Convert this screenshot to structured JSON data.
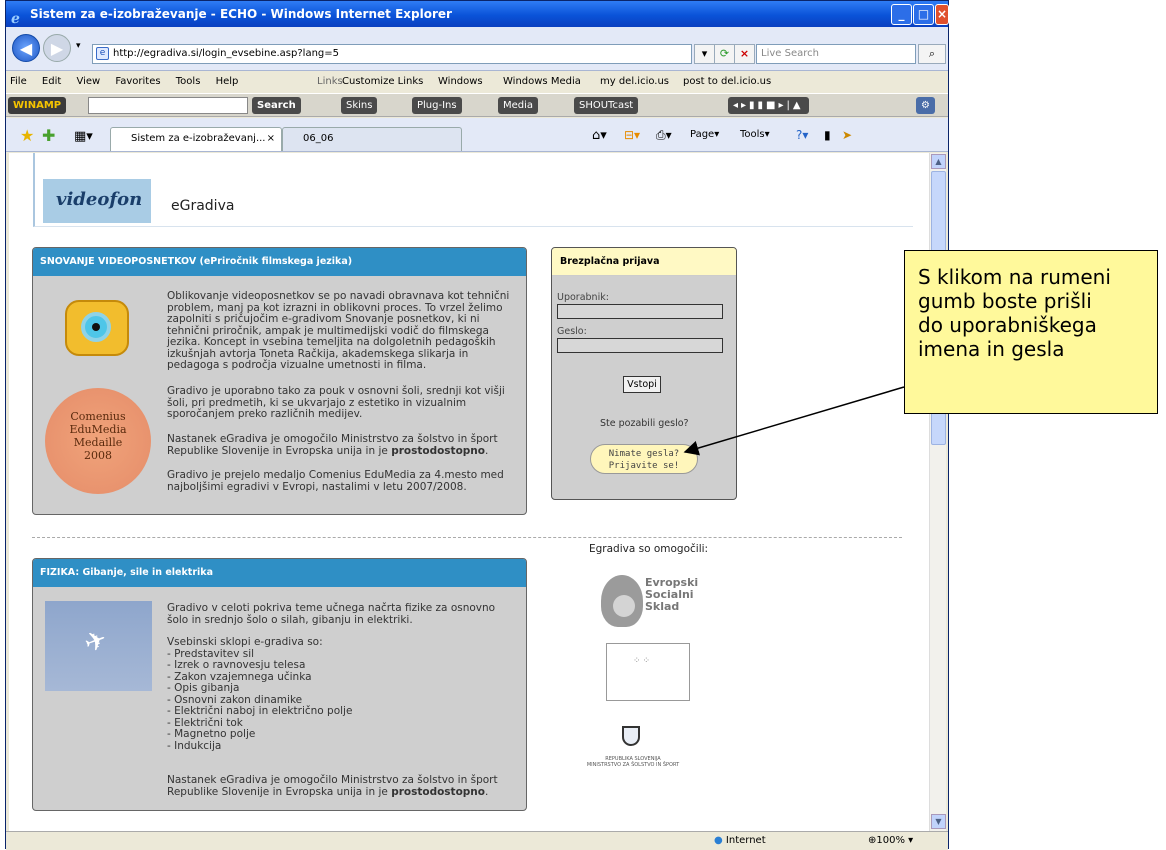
{
  "window": {
    "title": "Sistem za e-izobraževanje - ECHO - Windows Internet Explorer"
  },
  "address": {
    "url": "http://egradiva.si/login_evsebine.asp?lang=5",
    "search_placeholder": "Live Search"
  },
  "menu": {
    "items": [
      "File",
      "Edit",
      "View",
      "Favorites",
      "Tools",
      "Help"
    ],
    "links_label": "Links",
    "links": [
      "Customize Links",
      "Windows",
      "Windows Media",
      "my del.icio.us",
      "post to del.icio.us"
    ]
  },
  "winamp": {
    "brand": "WINAMP",
    "search_btn": "Search",
    "buttons": [
      "Skins",
      "Plug-Ins",
      "Media",
      "SHOUTcast"
    ]
  },
  "tabs": {
    "items": [
      "Sistem za e-izobraževanj...",
      "06_06"
    ],
    "commands": [
      "Page",
      "Tools"
    ]
  },
  "site": {
    "brand": "videofon",
    "title": "eGradiva"
  },
  "course1": {
    "header": "SNOVANJE VIDEOPOSNETKOV (ePriročnik filmskega jezika)",
    "p1": "Oblikovanje videoposnetkov se po navadi obravnava kot tehnični\nproblem, manj pa kot izrazni in oblikovni proces. To vrzel želimo\nzapolniti s pričujočim e-gradivom Snovanje posnetkov, ki ni\ntehnični priročnik, ampak je multimedijski vodič do filmskega\njezika. Koncept in vsebina temeljita na dolgoletnih pedagoških\nizkušnjah avtorja Toneta Račkija, akademskega slikarja in\npedagoga s področja vizualne umetnosti in filma.",
    "p2": "Gradivo je uporabno tako za pouk v osnovni šoli, srednji kot višji\nšoli, pri predmetih, ki se ukvarjajo z estetiko in vizualnim\nsporočanjem preko različnih medijev.",
    "p3_text": "Nastanek eGradiva je omogočilo Ministrstvo za šolstvo in šport\nRepublike Slovenije in Evropska unija in je ",
    "p3_bold": "prostodostopno",
    "p4": "Gradivo je prejelo medaljo Comenius EduMedia za 4.mesto med\nnajboljšimi egradivi v Evropi, nastalimi v letu 2007/2008.",
    "medal": "Comenius\nEduMedia\nMedaille\n2008"
  },
  "login": {
    "header": "Brezplačna prijava",
    "user_label": "Uporabnik:",
    "pass_label": "Geslo:",
    "submit": "Vstopi",
    "forgot": "Ste pozabili geslo?",
    "register": "Nimate gesla?\nPrijavite se!"
  },
  "course2": {
    "header": "FIZIKA: Gibanje, sile in elektrika",
    "p1": "Gradivo v celoti pokriva teme učnega načrta fizike za osnovno\nšolo in srednjo šolo o silah, gibanju in elektriki.",
    "p2": "Vsebinski sklopi e-gradiva so:\n- Predstavitev sil\n- Izrek o ravnovesju telesa\n- Zakon vzajemnega učinka\n- Opis gibanja\n- Osnovni zakon dinamike\n- Električni naboj in električno polje\n- Električni tok\n- Magnetno polje\n- Indukcija",
    "p3_text": "Nastanek eGradiva je omogočilo Ministrstvo za šolstvo in šport\nRepublike Slovenije in Evropska unija in je ",
    "p3_bold": "prostodostopno"
  },
  "sponsors": {
    "title": "Egradiva so omogočili:",
    "esf": "Evropski\nSocialni\nSklad",
    "ministry": "REPUBLIKA SLOVENIJA\nMINISTRSTVO ZA ŠOLSTVO IN ŠPORT"
  },
  "status": {
    "zone": "Internet",
    "zoom": "100%"
  },
  "callout": {
    "text": "S klikom na rumeni\ngumb boste prišli\ndo uporabniškega\nimena in gesla"
  }
}
